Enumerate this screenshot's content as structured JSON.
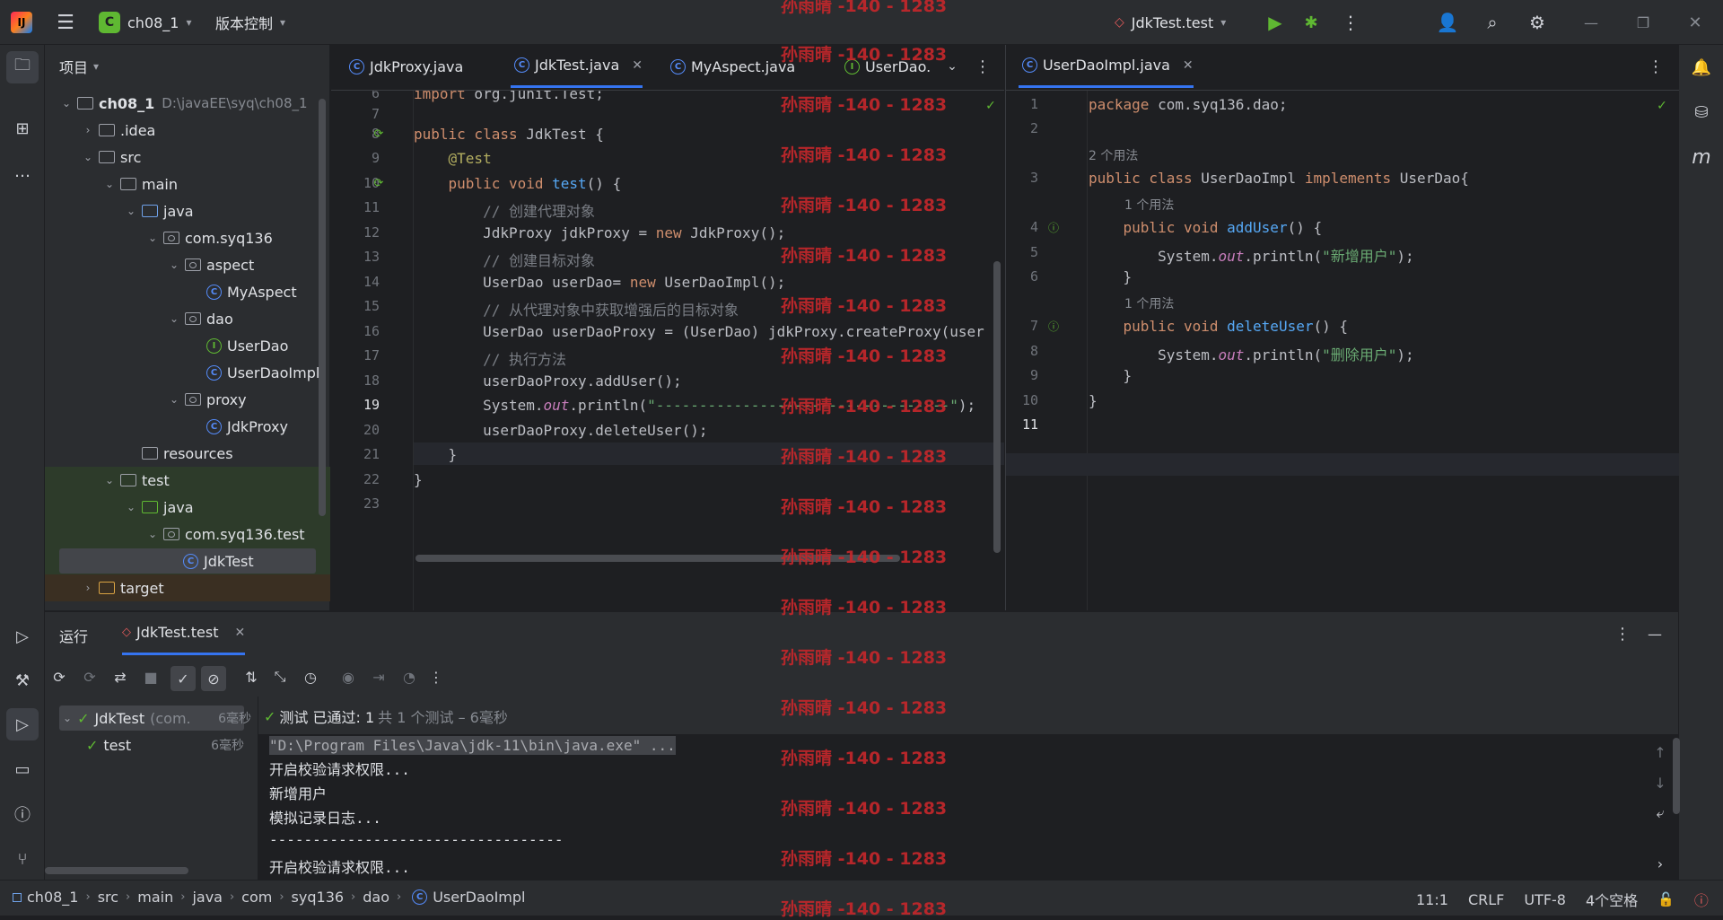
{
  "topbar": {
    "project_badge": "C",
    "project_name": "ch08_1",
    "vcs_label": "版本控制",
    "run_config": "JdkTest.test"
  },
  "project_panel": {
    "title": "项目",
    "root_name": "ch08_1",
    "root_path": "D:\\javaEE\\syq\\ch08_1",
    "items": [
      {
        "label": ".idea"
      },
      {
        "label": "src"
      },
      {
        "label": "main"
      },
      {
        "label": "java"
      },
      {
        "label": "com.syq136"
      },
      {
        "label": "aspect"
      },
      {
        "label": "MyAspect"
      },
      {
        "label": "dao"
      },
      {
        "label": "UserDao"
      },
      {
        "label": "UserDaoImpl"
      },
      {
        "label": "proxy"
      },
      {
        "label": "JdkProxy"
      },
      {
        "label": "resources"
      },
      {
        "label": "test"
      },
      {
        "label": "java"
      },
      {
        "label": "com.syq136.test"
      },
      {
        "label": "JdkTest"
      },
      {
        "label": "target"
      }
    ]
  },
  "editor_left": {
    "tabs": [
      {
        "label": "JdkProxy.java"
      },
      {
        "label": "JdkTest.java"
      },
      {
        "label": "MyAspect.java"
      },
      {
        "label": "UserDao."
      }
    ],
    "lines": [
      {
        "n": "6",
        "code": "import org.junit.Test;"
      },
      {
        "n": "7",
        "code": ""
      },
      {
        "n": "8",
        "code": "public class JdkTest {"
      },
      {
        "n": "9",
        "code": "    @Test"
      },
      {
        "n": "10",
        "code": "    public void test() {"
      },
      {
        "n": "11",
        "code": "        // 创建代理对象"
      },
      {
        "n": "12",
        "code": "        JdkProxy jdkProxy = new JdkProxy();"
      },
      {
        "n": "13",
        "code": "        // 创建目标对象"
      },
      {
        "n": "14",
        "code": "        UserDao userDao= new UserDaoImpl();"
      },
      {
        "n": "15",
        "code": "        // 从代理对象中获取增强后的目标对象"
      },
      {
        "n": "16",
        "code": "        UserDao userDaoProxy = (UserDao) jdkProxy.createProxy(user"
      },
      {
        "n": "17",
        "code": "        // 执行方法"
      },
      {
        "n": "18",
        "code": "        userDaoProxy.addUser();"
      },
      {
        "n": "19",
        "code": "        System.out.println(\"----------------------------------\");"
      },
      {
        "n": "20",
        "code": "        userDaoProxy.deleteUser();"
      },
      {
        "n": "21",
        "code": "    }"
      },
      {
        "n": "22",
        "code": "}"
      },
      {
        "n": "23",
        "code": ""
      }
    ]
  },
  "editor_right": {
    "tab": "UserDaoImpl.java",
    "usage_2": "2 个用法",
    "usage_1": "1 个用法",
    "lines": [
      {
        "n": "1",
        "code": "package com.syq136.dao;"
      },
      {
        "n": "2",
        "code": ""
      },
      {
        "n": "3",
        "code": "public class UserDaoImpl implements UserDao{"
      },
      {
        "n": "4",
        "code": "    public void addUser() {"
      },
      {
        "n": "5",
        "code": "        System.out.println(\"新增用户\");"
      },
      {
        "n": "6",
        "code": "    }"
      },
      {
        "n": "7",
        "code": "    public void deleteUser() {"
      },
      {
        "n": "8",
        "code": "        System.out.println(\"删除用户\");"
      },
      {
        "n": "9",
        "code": "    }"
      },
      {
        "n": "10",
        "code": "}"
      },
      {
        "n": "11",
        "code": ""
      }
    ]
  },
  "run_panel": {
    "title": "运行",
    "tab": "JdkTest.test",
    "tree": [
      {
        "label": "JdkTest",
        "detail": "(com.",
        "time": "6毫秒"
      },
      {
        "label": "test",
        "detail": "",
        "time": "6毫秒"
      }
    ],
    "summary_pass": "测试 已通过: 1",
    "summary_rest": "共 1 个测试 – 6毫秒",
    "console": [
      "\"D:\\Program Files\\Java\\jdk-11\\bin\\java.exe\" ...",
      "开启校验请求权限...",
      "新增用户",
      "模拟记录日志...",
      "----------------------------------",
      "开启校验请求权限..."
    ]
  },
  "statusbar": {
    "crumbs": [
      "ch08_1",
      "src",
      "main",
      "java",
      "com",
      "syq136",
      "dao",
      "UserDaoImpl"
    ],
    "position": "11:1",
    "line_sep": "CRLF",
    "encoding": "UTF-8",
    "indent": "4个空格"
  },
  "watermark": "孙雨晴 -140 - 1283",
  "colors": {
    "accent": "#3574f0",
    "warn": "#c7272b",
    "ok": "#5fb832"
  }
}
